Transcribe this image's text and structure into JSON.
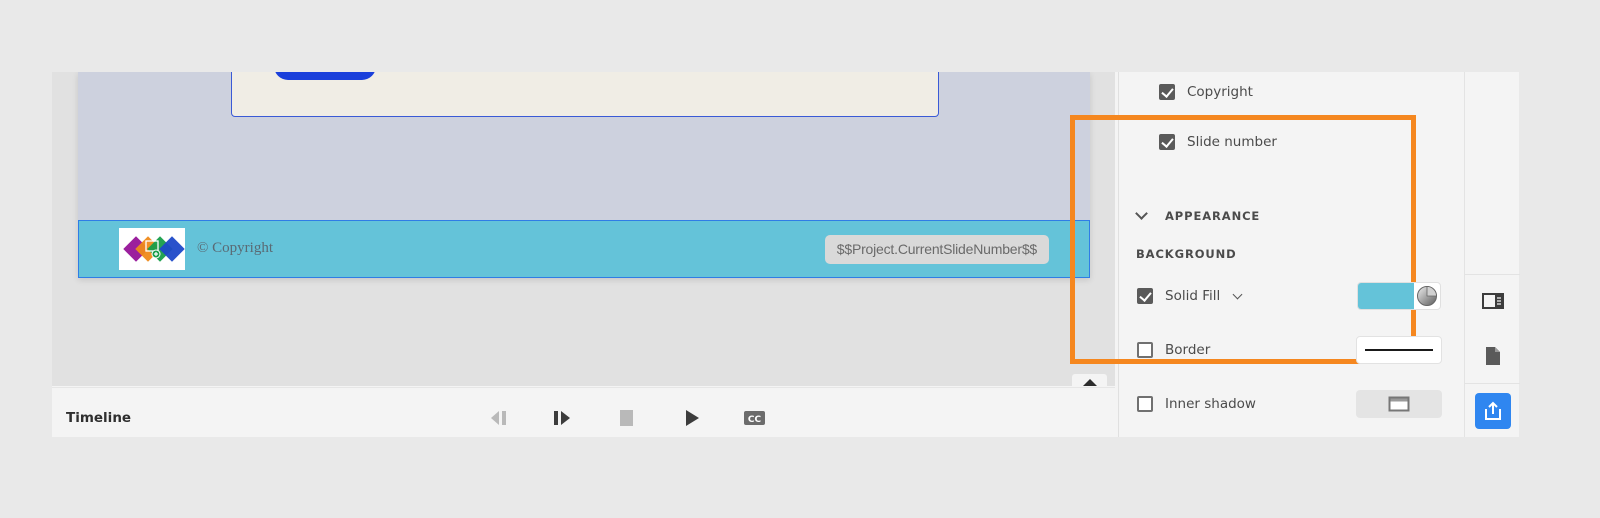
{
  "stage": {
    "footer": {
      "copyright_text": "© Copyright",
      "slide_number_field": "$$Project.CurrentSlideNumber$$",
      "background_color": "#64c3d9"
    }
  },
  "timeline": {
    "label": "Timeline",
    "controls": [
      {
        "name": "previous",
        "icon": "step-back-icon",
        "enabled": false
      },
      {
        "name": "next",
        "icon": "step-forward-icon",
        "enabled": true
      },
      {
        "name": "stop",
        "icon": "stop-icon",
        "enabled": false
      },
      {
        "name": "play",
        "icon": "play-icon",
        "enabled": true
      },
      {
        "name": "closed-captions",
        "icon": "cc-icon",
        "label": "CC",
        "enabled": true
      }
    ]
  },
  "properties": {
    "footer_options": [
      {
        "label": "Copyright",
        "checked": true
      },
      {
        "label": "Slide number",
        "checked": true
      }
    ],
    "appearance": {
      "title": "APPEARANCE",
      "background_title": "BACKGROUND",
      "solid_fill": {
        "label": "Solid Fill",
        "checked": true,
        "color": "#64c3d9"
      },
      "border": {
        "label": "Border",
        "checked": false
      },
      "inner_shadow": {
        "label": "Inner shadow",
        "checked": false
      }
    },
    "highlight_color": "#f5871f"
  },
  "rail": {
    "buttons": [
      {
        "name": "properties-panel",
        "icon": "panel-layout-icon"
      },
      {
        "name": "document",
        "icon": "document-icon"
      },
      {
        "name": "publish",
        "icon": "share-upload-icon",
        "active": true
      }
    ]
  }
}
